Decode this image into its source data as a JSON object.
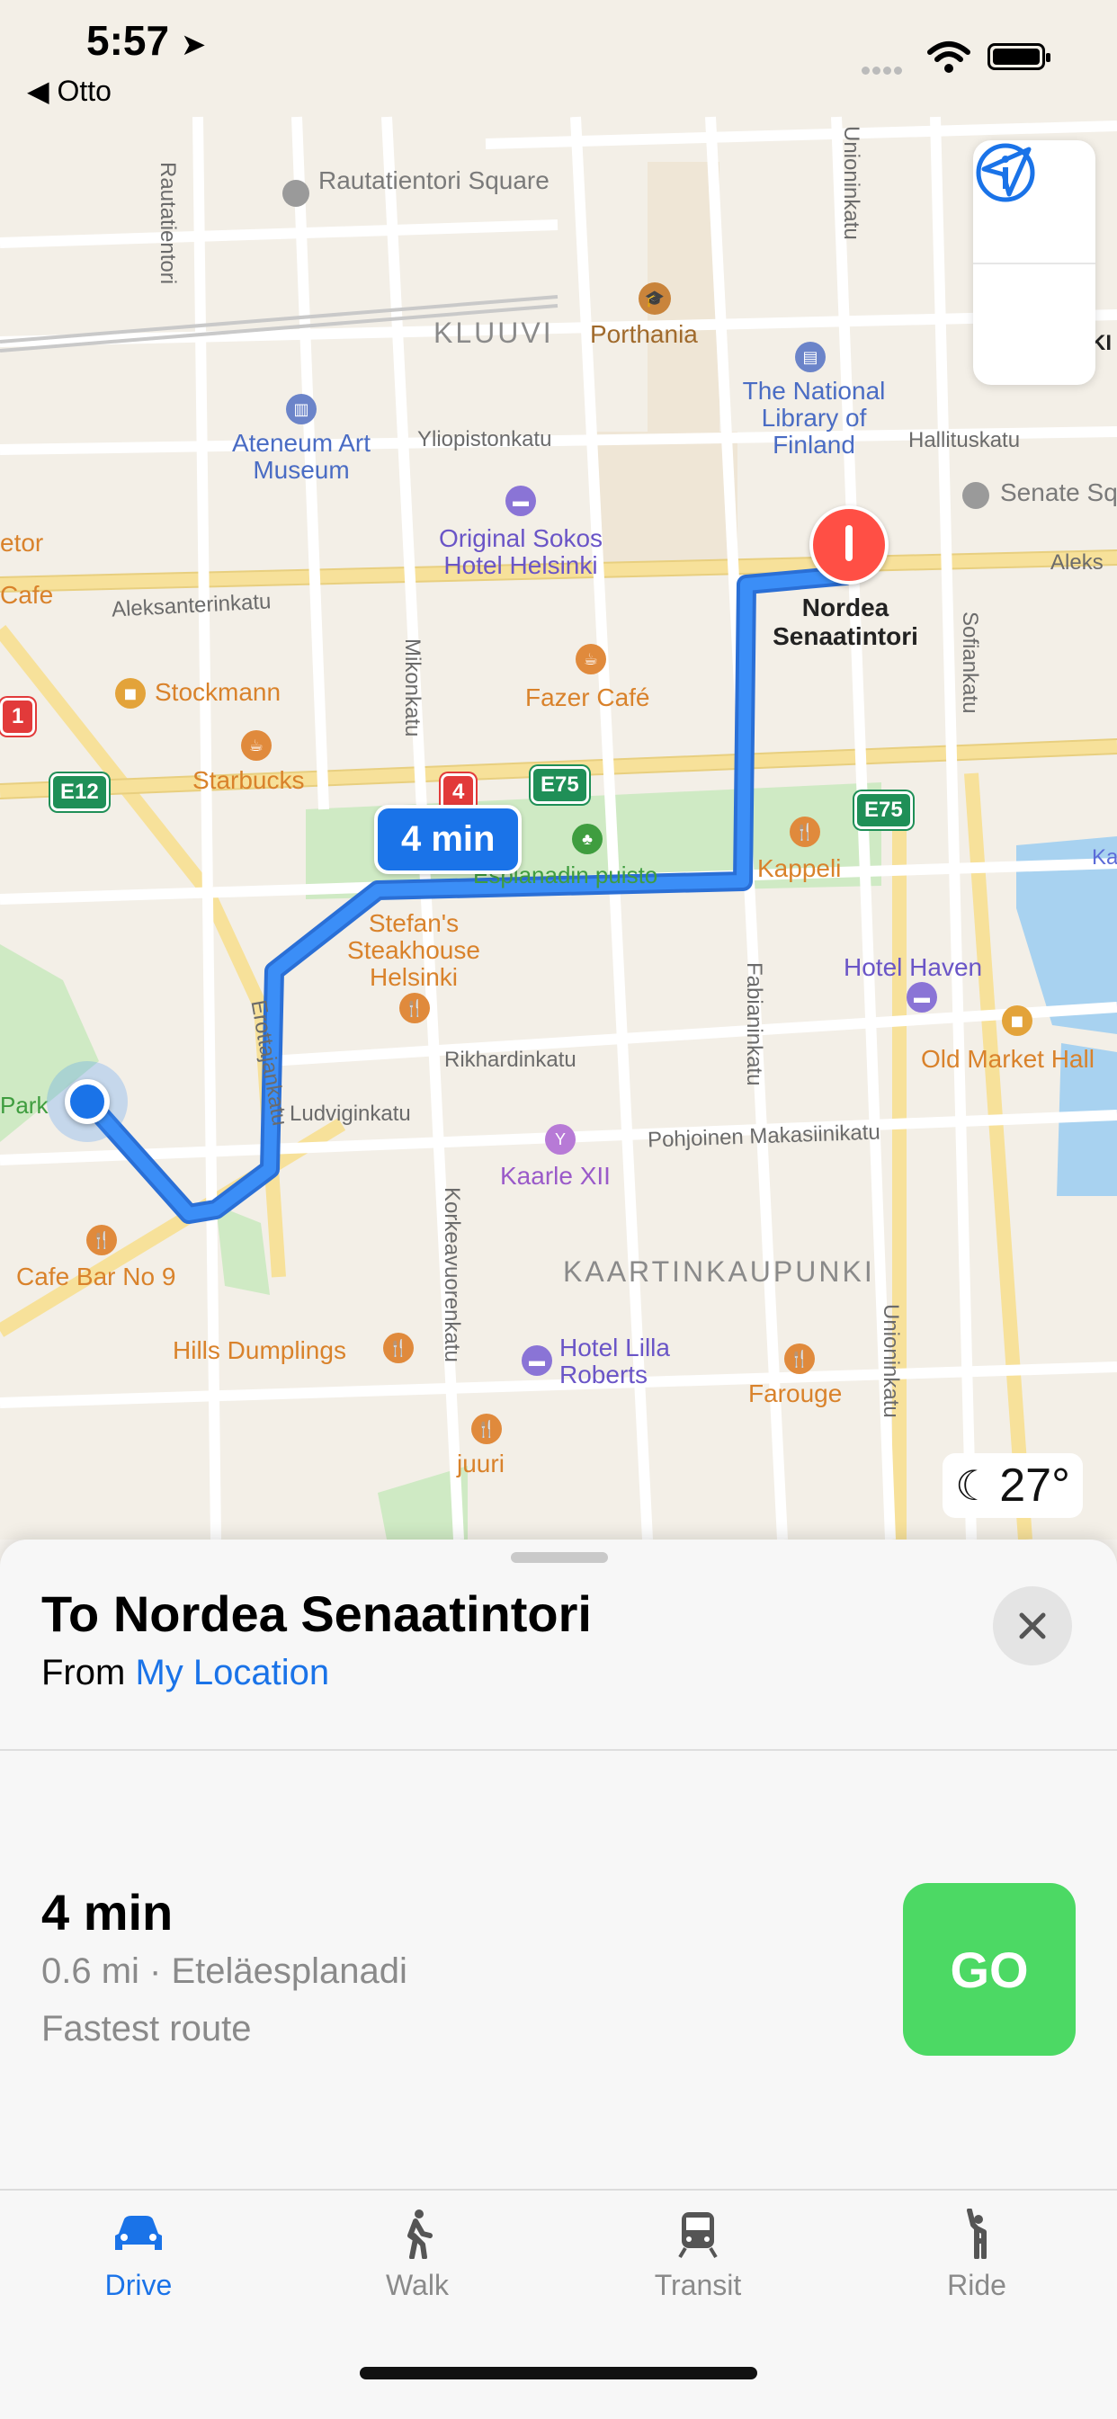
{
  "status_bar": {
    "time": "5:57",
    "back_label": "◀ Otto"
  },
  "map": {
    "districts": [
      "KLUUVI",
      "KAARTINKAUPUNKI"
    ],
    "streets": [
      "Rautatientori",
      "Yliopistonkatu",
      "Aleksanterinkatu",
      "Mikonkatu",
      "Unioninkatu",
      "Hallituskatu",
      "Sofiankatu",
      "Fabianinkatu",
      "Erottajankatu",
      "Ludviginkatu",
      "Rikhardinkatu",
      "Pohjoinen Makasiinikatu",
      "Korkeavuorenkatu",
      "Aleks"
    ],
    "pois": {
      "rautatientori_square": "Rautatientori Square",
      "porthania": "Porthania",
      "national_library": "The National Library of Finland",
      "ateneum": "Ateneum Art Museum",
      "sokos": "Original Sokos Hotel Helsinki",
      "senate": "Senate Sq",
      "stockmann": "Stockmann",
      "fazer": "Fazer Café",
      "starbucks": "Starbucks",
      "stefans": "Stefan's Steakhouse Helsinki",
      "kappeli": "Kappeli",
      "hotel_haven": "Hotel Haven",
      "old_market": "Old Market Hall",
      "kaarle": "Kaarle XII",
      "cafe_bar": "Cafe Bar No 9",
      "hills": "Hills Dumplings",
      "lilla_roberts": "Hotel Lilla Roberts",
      "farouge": "Farouge",
      "juuri": "juuri",
      "park_fragment": "Park",
      "etor_fragment": "etor",
      "cafe_fragment": "Cafe",
      "ki_fragment": "KI",
      "ka_fragment": "Ka"
    },
    "park_label": "Esplanadin puisto",
    "destination": [
      "Nordea",
      "Senaatintori"
    ],
    "shields": {
      "e12": "E12",
      "e75a": "E75",
      "e75b": "E75",
      "r4": "4",
      "r1": "1"
    },
    "eta_bubble": "4 min",
    "weather_temp": "27°",
    "route_color": "#3b8ef7"
  },
  "sheet": {
    "title": "To Nordea Senaatintori",
    "from_prefix": "From ",
    "from_link": "My Location",
    "route_time": "4 min",
    "route_distance": "0.6 mi · Eteläesplanadi",
    "route_desc": "Fastest route",
    "go_label": "GO"
  },
  "tabs": [
    {
      "label": "Drive",
      "icon": "car-icon",
      "active": true
    },
    {
      "label": "Walk",
      "icon": "walk-icon",
      "active": false
    },
    {
      "label": "Transit",
      "icon": "train-icon",
      "active": false
    },
    {
      "label": "Ride",
      "icon": "ride-icon",
      "active": false
    }
  ],
  "colors": {
    "accent": "#1a73e8",
    "go": "#4cd964",
    "inactive": "#8a8a8a"
  }
}
